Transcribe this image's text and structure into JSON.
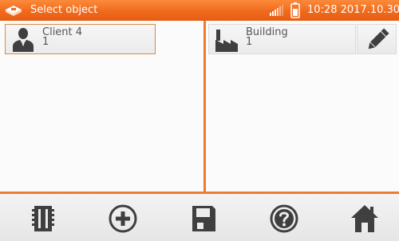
{
  "titlebar": {
    "title": "Select object",
    "clock": "10:28 2017.10.30",
    "app_icon": "meter-icon",
    "signal_icon": "signal-icon",
    "battery_icon": "battery-icon"
  },
  "left_panel": {
    "items": [
      {
        "name": "Client 4",
        "count": "1",
        "icon": "person-icon",
        "selected": true
      }
    ]
  },
  "right_panel": {
    "items": [
      {
        "name": "Building",
        "count": "1",
        "icon": "factory-icon"
      }
    ],
    "edit_icon": "pencil-icon"
  },
  "toolbar": {
    "buttons": [
      {
        "name": "memory-card-icon"
      },
      {
        "name": "add-icon"
      },
      {
        "name": "save-icon"
      },
      {
        "name": "help-icon"
      },
      {
        "name": "home-icon"
      }
    ]
  },
  "colors": {
    "accent": "#f07a2e",
    "titlebar": "#f06a1c",
    "icon_dark": "#3f3f3f"
  }
}
